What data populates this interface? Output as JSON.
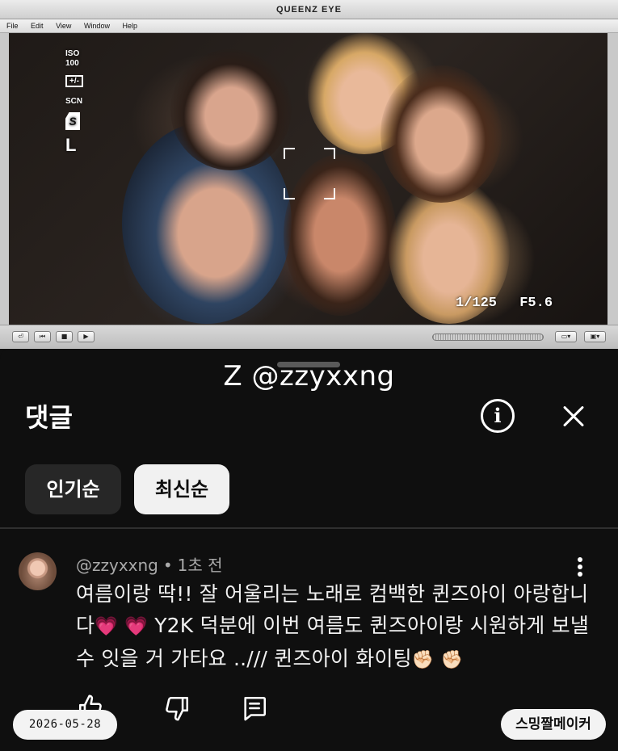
{
  "player": {
    "window_title": "QUEENZ EYE",
    "menu": [
      "File",
      "Edit",
      "View",
      "Window",
      "Help"
    ],
    "viewfinder": {
      "iso_label": "ISO",
      "iso_value": "100",
      "exposure_comp": "+/-",
      "scene_label": "SCN",
      "mode_icon_text": "S",
      "size_label": "L",
      "shutter": "1/125",
      "aperture": "F5.6"
    }
  },
  "watermark": "Z @zzyxxng",
  "sheet": {
    "title": "댓글",
    "sort_chips": [
      "인기순",
      "최신순"
    ]
  },
  "comment": {
    "author": "@zzyxxng",
    "separator": "•",
    "time": "1초 전",
    "text_part1": "여름이랑 딱!! 잘 어울리는 노래로 컴백한 퀸즈아이 아랑합니다",
    "emoji_heart": "💗",
    "text_part2": " Y2K 덕분에 이번 여름도 퀸즈아이랑 시원하게 보낼 수 잇을 거 가타요 ..///  퀸즈아이 화이팅",
    "emoji_fist": "✊🏻"
  },
  "footer": {
    "date": "2026-05-28",
    "maker": "스밍짤메이커"
  },
  "colors": {
    "sheet_bg": "#0f0f0f",
    "chip_inactive": "#272727",
    "chip_active": "#f1f1f1",
    "meta_text": "#aaaaaa",
    "heart": "#ff4fb8"
  }
}
